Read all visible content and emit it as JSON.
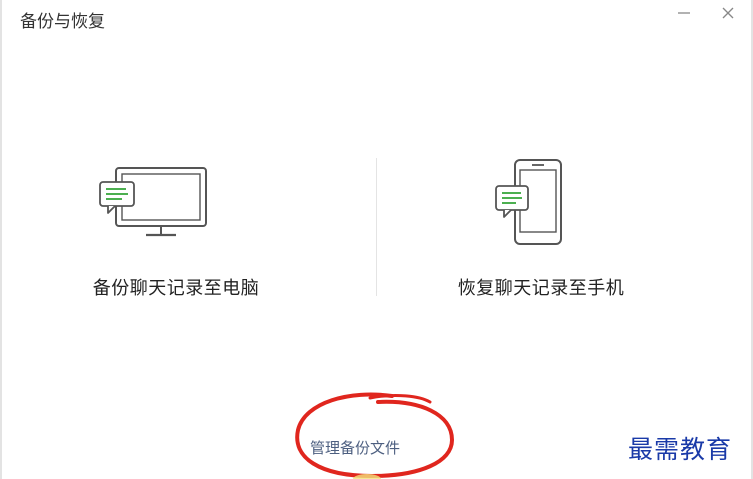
{
  "window": {
    "title": "备份与恢复",
    "minimize_icon": "minimize-icon",
    "close_icon": "close-icon"
  },
  "options": [
    {
      "label": "备份聊天记录至电脑",
      "icon": "monitor-chat-icon"
    },
    {
      "label": "恢复聊天记录至手机",
      "icon": "phone-chat-icon"
    }
  ],
  "footer": {
    "manage_link": "管理备份文件"
  },
  "watermark": "最需教育",
  "colors": {
    "icon_stroke": "#555555",
    "chat_accent": "#4caf50",
    "annotation_red": "#e0261e",
    "link": "#4d5f80",
    "watermark": "#1a3aa8"
  }
}
